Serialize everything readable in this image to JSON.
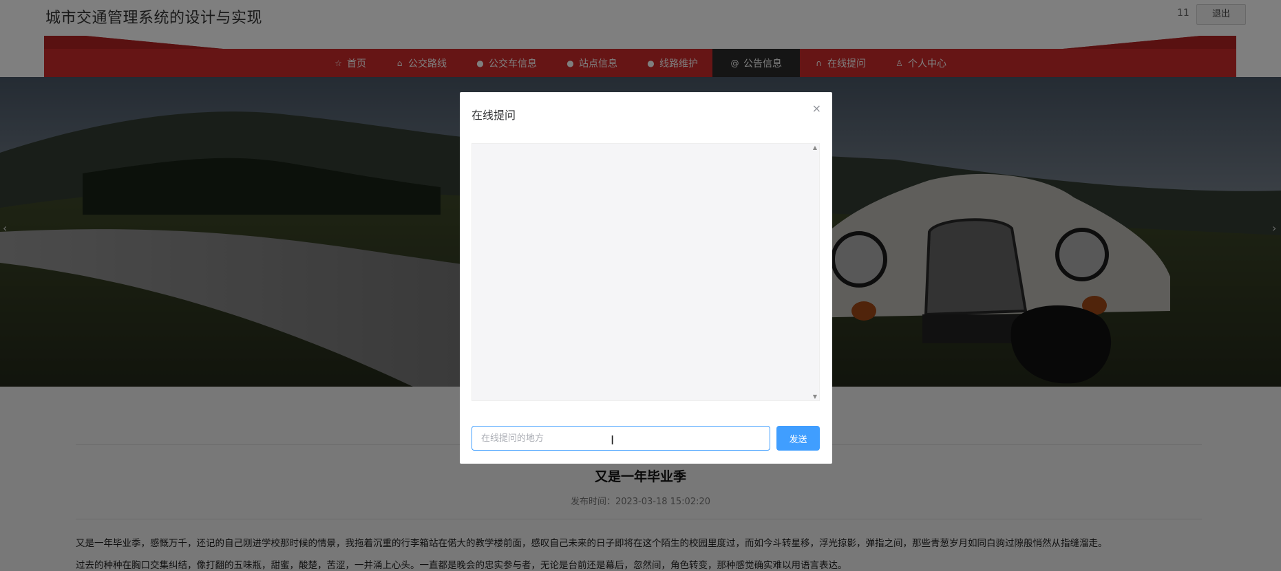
{
  "header": {
    "title": "城市交通管理系统的设计与实现",
    "username": "11",
    "logout_label": "退出"
  },
  "nav": {
    "items": [
      {
        "label": "首页",
        "icon": "star-icon",
        "glyph": "☆"
      },
      {
        "label": "公交路线",
        "icon": "lock-icon",
        "glyph": "⌂"
      },
      {
        "label": "公交车信息",
        "icon": "info-circle-icon",
        "glyph": "●"
      },
      {
        "label": "站点信息",
        "icon": "question-circle-icon",
        "glyph": "●"
      },
      {
        "label": "线路维护",
        "icon": "info-circle-icon",
        "glyph": "●"
      },
      {
        "label": "公告信息",
        "icon": "at-icon",
        "glyph": "@"
      },
      {
        "label": "在线提问",
        "icon": "headset-icon",
        "glyph": "∩"
      },
      {
        "label": "个人中心",
        "icon": "user-icon",
        "glyph": "♙"
      }
    ],
    "active_index": 5
  },
  "carousel": {
    "prev_glyph": "‹",
    "next_glyph": "›"
  },
  "article": {
    "title": "又是一年毕业季",
    "publish_time": "发布时间：2023-03-18 15:02:20",
    "paragraph1": "又是一年毕业季，感慨万千，还记的自己刚进学校那时候的情景，我拖着沉重的行李箱站在偌大的教学楼前面，感叹自己未来的日子即将在这个陌生的校园里度过，而如今斗转星移，浮光掠影，弹指之间，那些青葱岁月如同白驹过隙般悄然从指缝溜走。",
    "paragraph2": "过去的种种在胸口交集纠结，像打翻的五味瓶，甜蜜，酸楚，苦涩，一并涌上心头。一直都是晚会的忠实参与者，无论是台前还是幕后，忽然间，角色转变，那种感觉确实难以用语言表达。"
  },
  "modal": {
    "title": "在线提问",
    "close_glyph": "×",
    "input_value": "",
    "input_placeholder": "在线提问的地方",
    "send_label": "发送",
    "scroll_up_glyph": "▲",
    "scroll_down_glyph": "▼"
  },
  "colors": {
    "nav_red": "#cc2a2a",
    "nav_active": "#2b2b2b",
    "primary": "#409eff"
  }
}
